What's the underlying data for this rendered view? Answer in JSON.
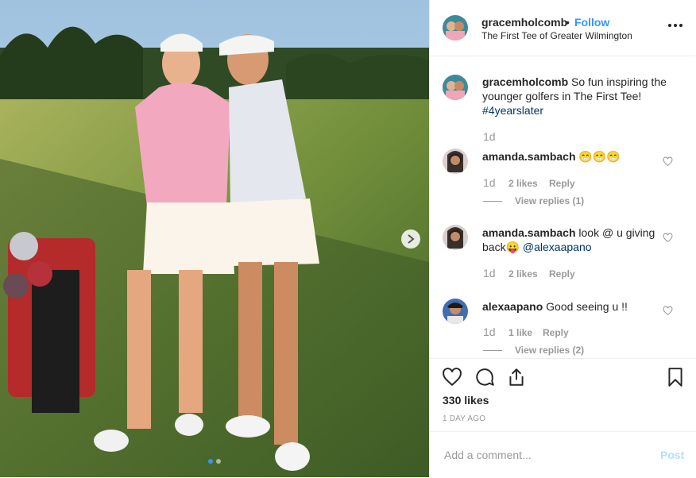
{
  "post": {
    "username": "gracemholcomb",
    "separator": "•",
    "follow_label": "Follow",
    "location": "The First Tee of Greater Wilmington"
  },
  "caption": {
    "username": "gracemholcomb",
    "text": "So fun inspiring the younger golfers in The First Tee!",
    "hashtag": "#4yearslater",
    "time": "1d"
  },
  "comments": [
    {
      "username": "amanda.sambach",
      "text": "😁😁😁",
      "time": "1d",
      "likes": "2 likes",
      "reply": "Reply",
      "view_replies": "View replies (1)"
    },
    {
      "username": "amanda.sambach",
      "text": "look @ u giving back😛",
      "mention": "@alexaapano",
      "time": "1d",
      "likes": "2 likes",
      "reply": "Reply"
    },
    {
      "username": "alexaapano",
      "text": "Good seeing u !!",
      "time": "1d",
      "likes": "1 like",
      "reply": "Reply",
      "view_replies": "View replies (2)"
    }
  ],
  "stats": {
    "likes": "330 likes",
    "date": "1 DAY AGO"
  },
  "add_comment": {
    "placeholder": "Add a comment...",
    "post_label": "Post"
  },
  "carousel": {
    "current": 1,
    "total": 2
  },
  "icons": [
    "chevron-right-icon",
    "more-icon",
    "heart-icon",
    "comment-icon",
    "share-icon",
    "bookmark-icon"
  ],
  "colors": {
    "accent": "#3897f0",
    "post_disabled": "#b2dffc",
    "hashtag": "#003569"
  }
}
